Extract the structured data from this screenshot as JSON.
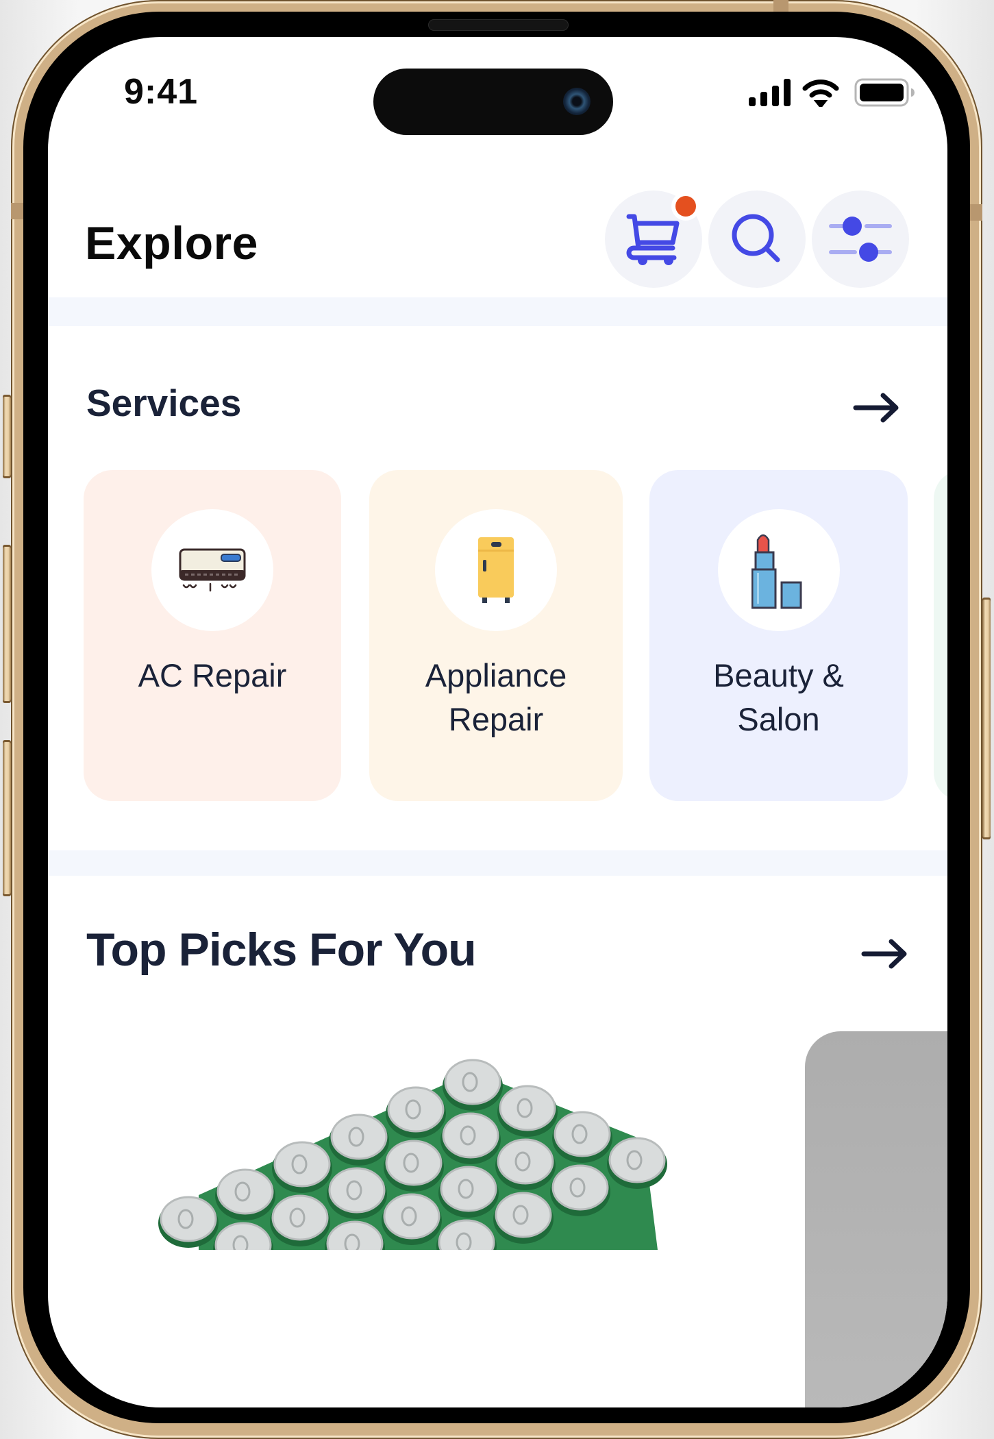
{
  "status_bar": {
    "time": "9:41",
    "icons": [
      "cellular-signal-icon",
      "wifi-icon",
      "battery-icon"
    ]
  },
  "header": {
    "title": "Explore",
    "actions": [
      {
        "name": "cart-button",
        "icon": "cart-icon",
        "has_badge": true
      },
      {
        "name": "search-button",
        "icon": "search-icon"
      },
      {
        "name": "filter-button",
        "icon": "sliders-icon"
      }
    ]
  },
  "services": {
    "title": "Services",
    "see_all_icon": "arrow-right-icon",
    "items": [
      {
        "label_line1": "AC Repair",
        "label_line2": "",
        "icon": "air-conditioner-icon",
        "bg": "#FEF0EA"
      },
      {
        "label_line1": "Appliance",
        "label_line2": "Repair",
        "icon": "refrigerator-icon",
        "bg": "#FEF5E8"
      },
      {
        "label_line1": "Beauty &",
        "label_line2": "Salon",
        "icon": "lipstick-icon",
        "bg": "#EDF0FE"
      },
      {
        "label_line1": "",
        "label_line2": "",
        "icon": "",
        "bg": "#EEF8F3"
      }
    ]
  },
  "top_picks": {
    "title": "Top Picks For You",
    "see_all_icon": "arrow-right-icon",
    "items": [
      {
        "image": "green-beverage-cans-pack"
      },
      {
        "image": "gray-placeholder"
      }
    ]
  },
  "colors": {
    "accent": "#4449E5",
    "badge": "#E4501F",
    "text_dark": "#1A2238",
    "band": "#F4F7FD",
    "button_bg": "#F2F3F8"
  }
}
